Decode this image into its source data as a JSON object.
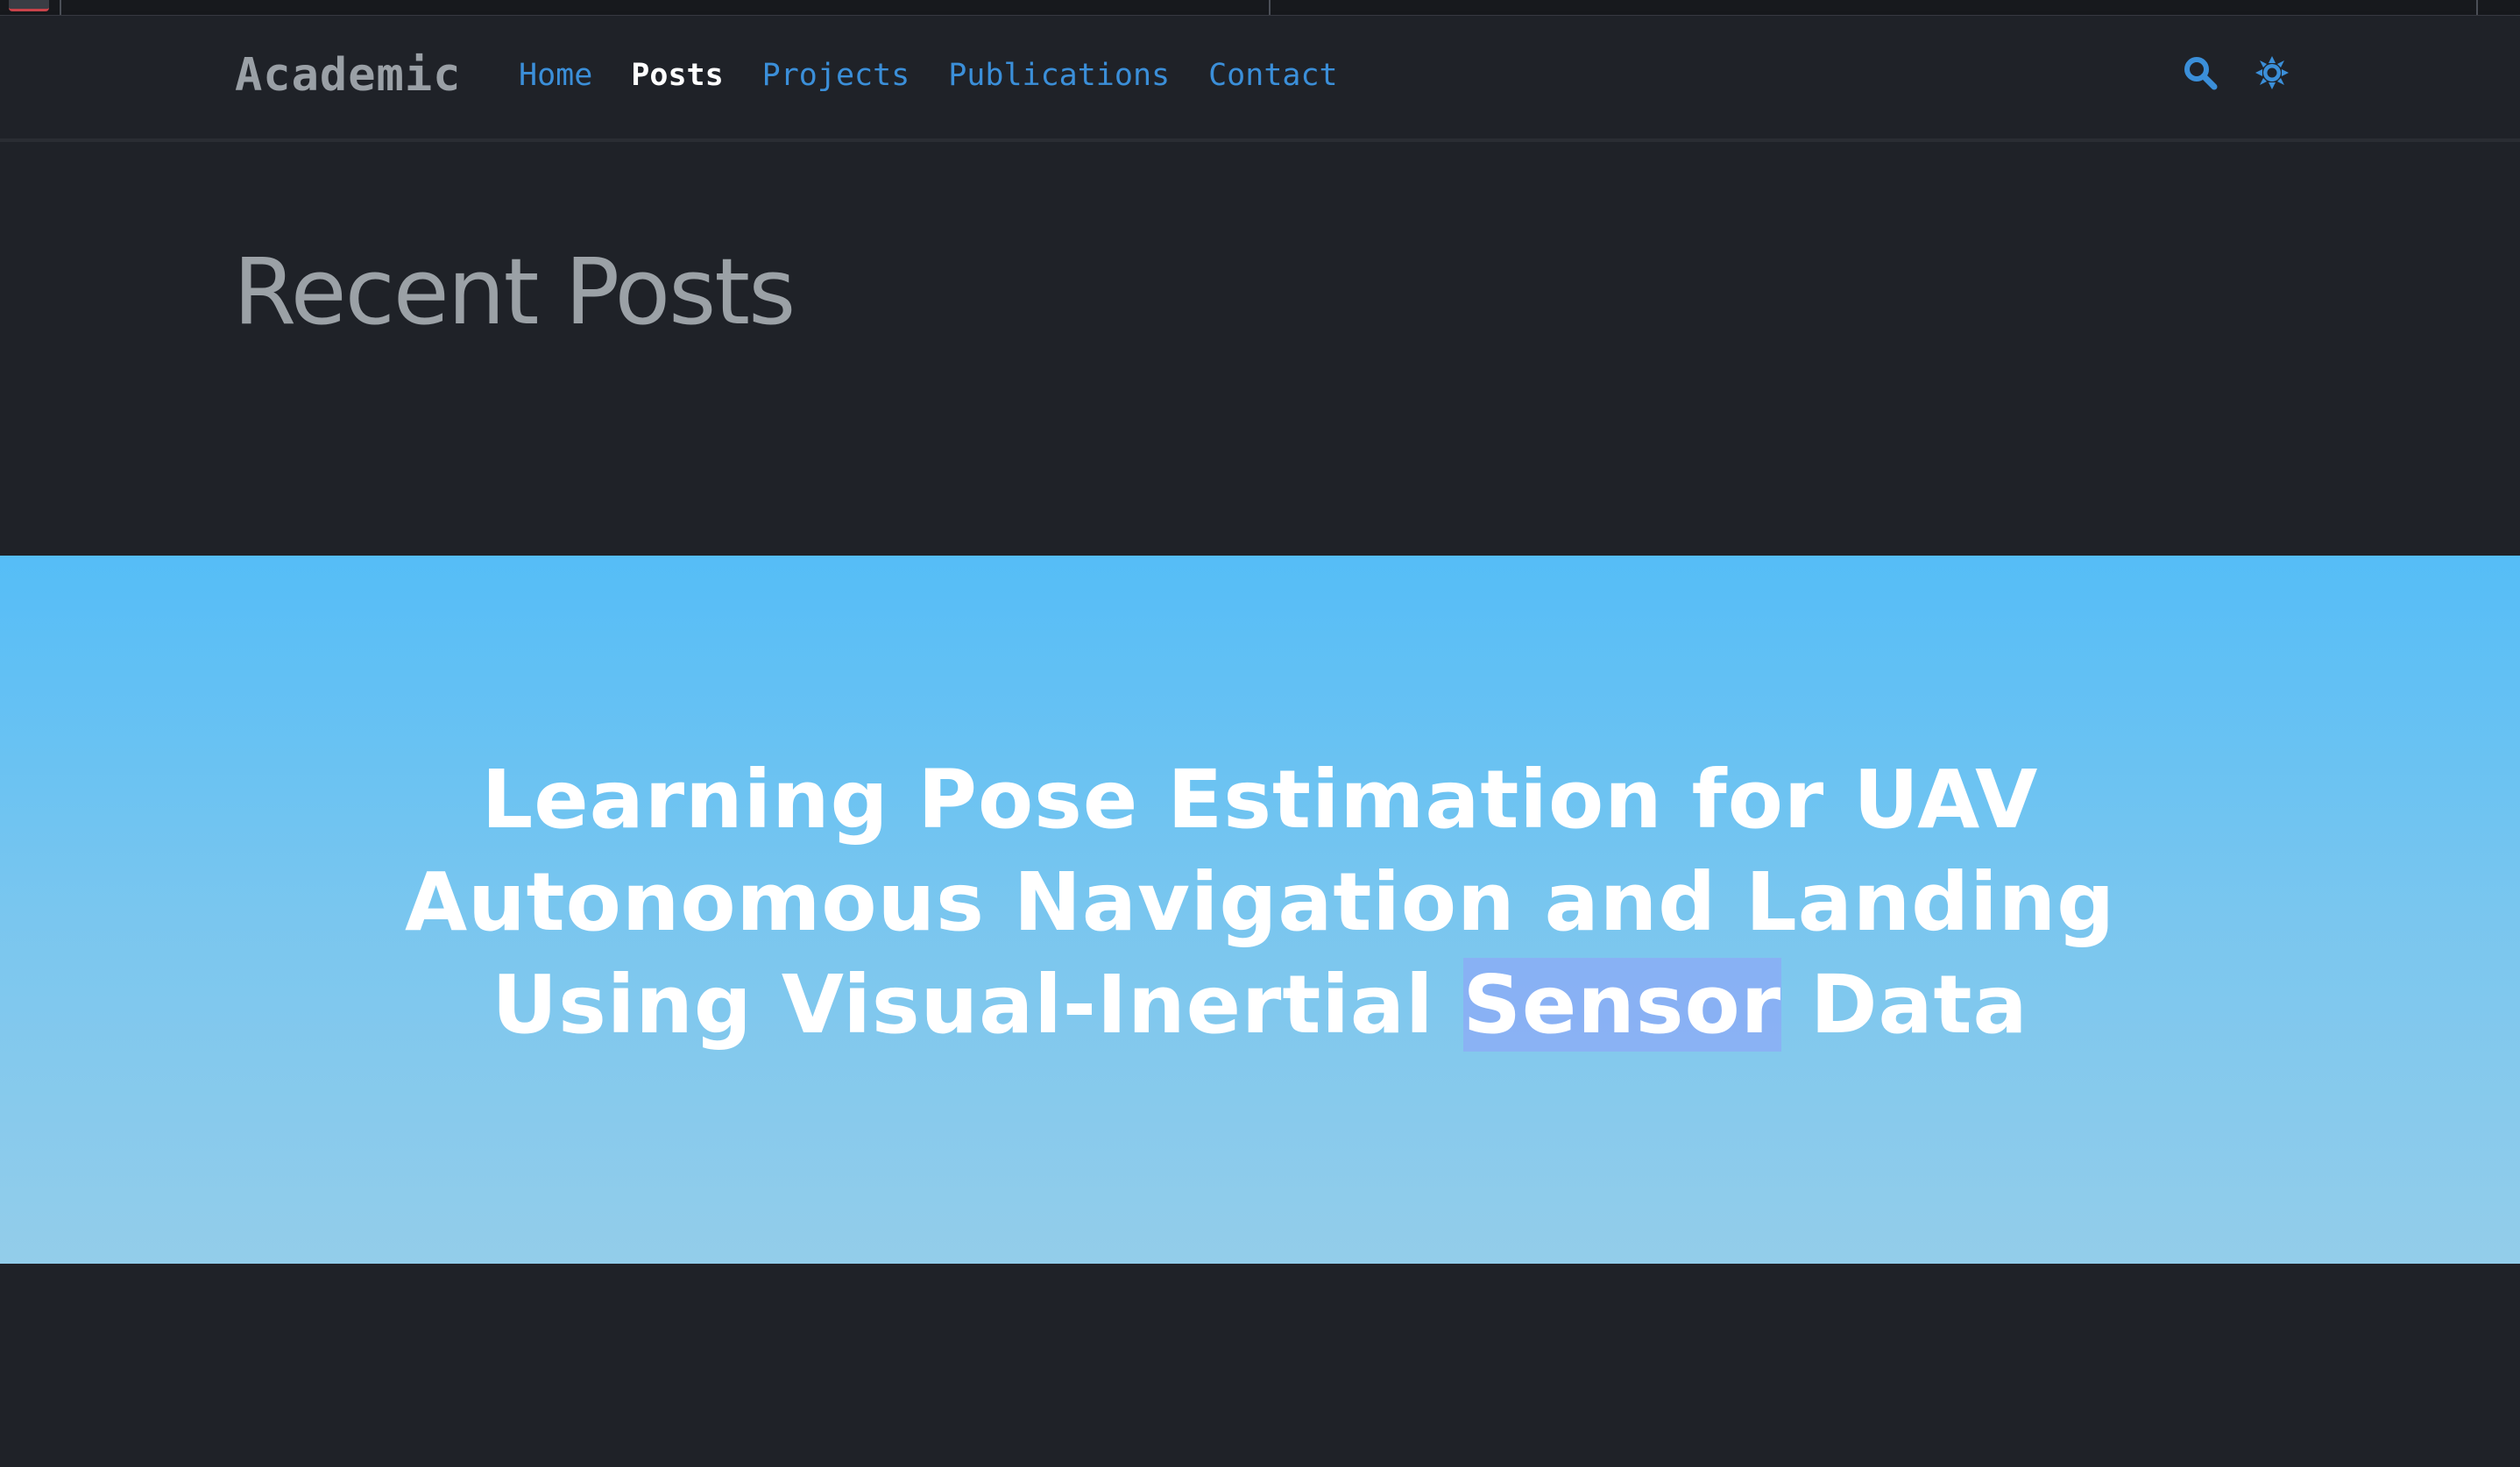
{
  "navbar": {
    "brand": "Academic",
    "links": [
      {
        "label": "Home",
        "active": false
      },
      {
        "label": "Posts",
        "active": true
      },
      {
        "label": "Projects",
        "active": false
      },
      {
        "label": "Publications",
        "active": false
      },
      {
        "label": "Contact",
        "active": false
      }
    ],
    "icons": [
      "search-icon",
      "theme-toggle-icon"
    ],
    "link_color": "#3b8fd9",
    "active_color": "#ffffff"
  },
  "header": {
    "title": "Recent Posts"
  },
  "hero": {
    "title_before": "Learning Pose Estimation for UAV Autonomous Navigation and Landing Using Visual-Inertial ",
    "title_highlight": "Sensor",
    "title_after": " Data",
    "gradient_top": "#55bdf7",
    "gradient_bottom": "#93cdea"
  },
  "colors": {
    "background": "#1f2228",
    "title_gray": "#9ba1a6"
  }
}
